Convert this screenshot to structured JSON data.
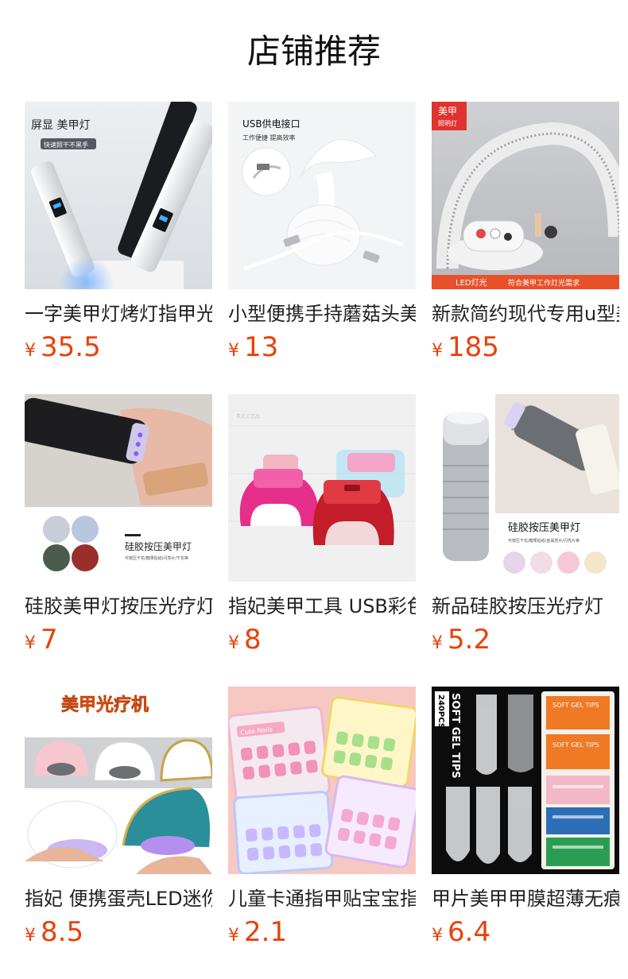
{
  "page": {
    "title": "店铺推荐"
  },
  "currency_symbol": "¥",
  "colors": {
    "price": "#e8420b",
    "text": "#222222"
  },
  "products": [
    {
      "name": "一字美甲灯烤灯指甲光疗灯",
      "price": "35.5",
      "image_icon": "pen-uv-lamp-icon",
      "image_text": {
        "line1": "屏显 美甲灯",
        "line2": "快速照干不黑手"
      }
    },
    {
      "name": "小型便携手持蘑菇头美甲灯",
      "price": "13",
      "image_icon": "mushroom-lamp-icon",
      "image_text": {
        "line1": "USB供电接口",
        "line2": "工作便捷 提高效率"
      }
    },
    {
      "name": "新款简约现代专用u型美甲灯",
      "price": "185",
      "image_icon": "arch-lamp-icon",
      "image_text": {
        "line1": "美甲",
        "line2": "照明灯",
        "line3": "LED灯光",
        "line4": "符合美甲工作灯光需求"
      }
    },
    {
      "name": "硅胶美甲灯按压光疗灯",
      "price": "7",
      "image_icon": "silicone-stamp-lamp-icon",
      "image_text": {
        "line1": "硅胶按压美甲灯",
        "line2": "可按压干花/糖果贴纸/闪亮片/干花等"
      }
    },
    {
      "name": "指妃美甲工具 USB彩色迷你灯",
      "price": "8",
      "image_icon": "mini-usb-lamp-icon",
      "image_text": {
        "line1": "素光工艺品"
      }
    },
    {
      "name": "新品硅胶按压光疗灯",
      "price": "5.2",
      "image_icon": "flashlight-lamp-icon",
      "image_text": {
        "line1": "硅胶按压美甲灯",
        "line2": "可按压干花/糖果贴纸/金属亮片/闪亮片等"
      }
    },
    {
      "name": "指妃 便携蛋壳LED迷你灯",
      "price": "8.5",
      "image_icon": "egg-lamp-icon",
      "image_text": {
        "line1": "美甲光疗机"
      }
    },
    {
      "name": "儿童卡通指甲贴宝宝指甲片",
      "price": "2.1",
      "image_icon": "kids-nail-sticker-icon",
      "image_text": {
        "line1": "Cute Nails"
      }
    },
    {
      "name": "甲片美甲甲膜超薄无痕甲片",
      "price": "6.4",
      "image_icon": "gel-tips-box-icon",
      "image_text": {
        "line1": "SOFT GEL TIPS",
        "line2": "240PCS",
        "line3": "SOFT GEL TIPS"
      }
    }
  ]
}
